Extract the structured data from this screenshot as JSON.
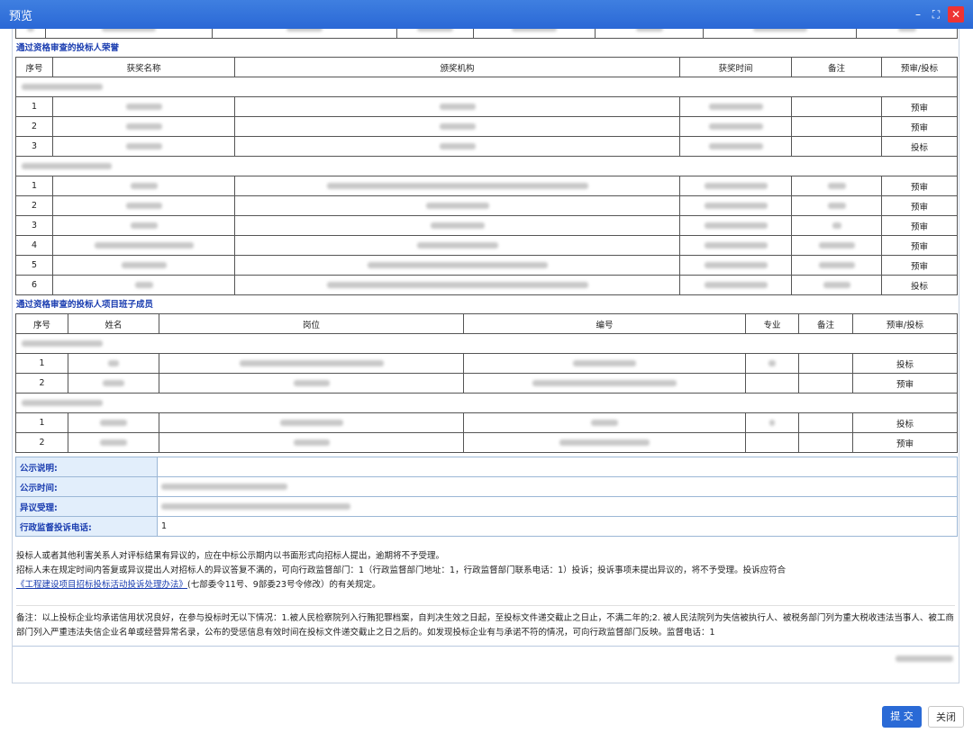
{
  "window": {
    "title": "预览"
  },
  "section1": {
    "title": "通过资格审查的投标人荣誉",
    "headers": [
      "序号",
      "获奖名称",
      "颁奖机构",
      "获奖时间",
      "备注",
      "预审/投标"
    ],
    "groups": [
      {
        "rows": [
          {
            "no": "1",
            "type": "预审"
          },
          {
            "no": "2",
            "type": "预审"
          },
          {
            "no": "3",
            "type": "投标"
          }
        ]
      },
      {
        "rows": [
          {
            "no": "1",
            "type": "预审"
          },
          {
            "no": "2",
            "type": "预审"
          },
          {
            "no": "3",
            "type": "预审"
          },
          {
            "no": "4",
            "type": "预审"
          },
          {
            "no": "5",
            "type": "预审"
          },
          {
            "no": "6",
            "type": "投标"
          }
        ]
      }
    ]
  },
  "section2": {
    "title": "通过资格审查的投标人项目班子成员",
    "headers": [
      "序号",
      "姓名",
      "岗位",
      "编号",
      "专业",
      "备注",
      "预审/投标"
    ],
    "groups": [
      {
        "rows": [
          {
            "no": "1",
            "type": "投标"
          },
          {
            "no": "2",
            "type": "预审"
          }
        ]
      },
      {
        "rows": [
          {
            "no": "1",
            "type": "投标"
          },
          {
            "no": "2",
            "type": "预审"
          }
        ]
      }
    ]
  },
  "info": {
    "desc_label": "公示说明:",
    "time_label": "公示时间:",
    "objection_label": "异议受理:",
    "phone_label": "行政监督投诉电话:",
    "phone_value": "1"
  },
  "notice": {
    "line1": "投标人或者其他利害关系人对评标结果有异议的，应在中标公示期内以书面形式向招标人提出，逾期将不予受理。",
    "line2_pre": "招标人未在规定时间内答复或异议提出人对招标人的异议答复不满的，可向行政监督部门：1（行政监督部门地址：1，行政监督部门联系电话：1）投诉；投诉事项未提出异议的，将不予受理。投诉应符合",
    "line2_link": "《工程建设项目招标投标活动投诉处理办法》",
    "line2_post": "(七部委令11号、9部委23号令修改）的有关规定。",
    "remark": "备注：以上投标企业均承诺信用状况良好，在参与投标时无以下情况：1.被人民检察院列入行贿犯罪档案，自判决生效之日起，至投标文件递交截止之日止，不满二年的;2. 被人民法院列为失信被执行人、被税务部门列为重大税收违法当事人、被工商部门列入严重违法失信企业名单或经营异常名录，公布的受惩信息有效时间在投标文件递交截止之日之后的。如发现投标企业有与承诺不符的情况，可向行政监督部门反映。监督电话：1"
  },
  "buttons": {
    "submit": "提 交",
    "close": "关闭"
  }
}
